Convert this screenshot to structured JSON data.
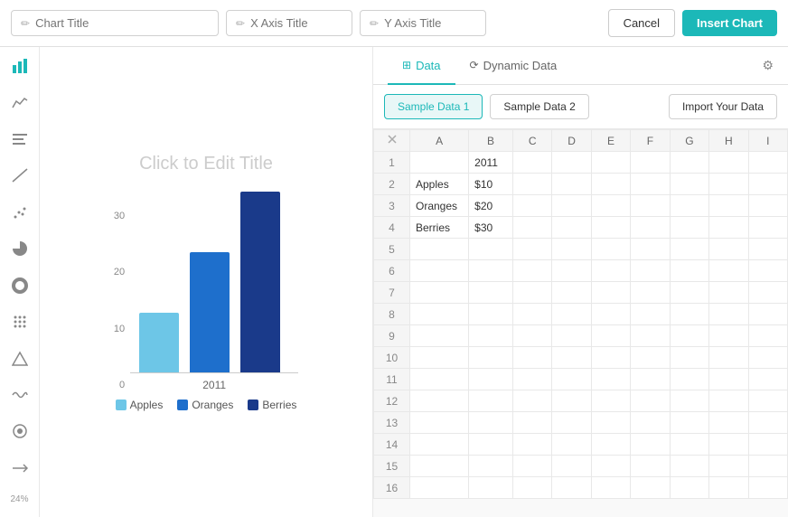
{
  "toolbar": {
    "chart_title_placeholder": "Chart Title",
    "x_axis_placeholder": "X Axis Title",
    "y_axis_placeholder": "Y Axis Title",
    "cancel_label": "Cancel",
    "insert_label": "Insert Chart"
  },
  "sidebar": {
    "icons": [
      {
        "name": "bar-chart-icon",
        "symbol": "▐",
        "active": true
      },
      {
        "name": "area-chart-icon",
        "symbol": "▲"
      },
      {
        "name": "list-chart-icon",
        "symbol": "≡"
      },
      {
        "name": "line-chart-icon",
        "symbol": "╱"
      },
      {
        "name": "scatter-chart-icon",
        "symbol": "⋯"
      },
      {
        "name": "pie-chart-icon",
        "symbol": "◑"
      },
      {
        "name": "donut-chart-icon",
        "symbol": "○"
      },
      {
        "name": "dot-grid-icon",
        "symbol": "⠿"
      },
      {
        "name": "triangle-chart-icon",
        "symbol": "△"
      },
      {
        "name": "wave-icon",
        "symbol": "〜"
      },
      {
        "name": "circle-icon",
        "symbol": "◎"
      },
      {
        "name": "flow-icon",
        "symbol": "⋱"
      }
    ],
    "zoom_label": "24%"
  },
  "chart": {
    "title_placeholder": "Click to Edit Title",
    "year_label": "2011",
    "bars": [
      {
        "label": "Apples",
        "value": 10,
        "color": "#6dc6e7"
      },
      {
        "label": "Oranges",
        "value": 20,
        "color": "#1e6fcc"
      },
      {
        "label": "Berries",
        "value": 30,
        "color": "#1a3a8a"
      }
    ],
    "y_ticks": [
      30,
      20,
      10,
      0
    ]
  },
  "panel": {
    "tab_data_label": "Data",
    "tab_dynamic_label": "Dynamic Data",
    "active_tab": "data",
    "sample1_label": "Sample Data 1",
    "sample2_label": "Sample Data 2",
    "import_label": "Import Your Data"
  },
  "spreadsheet": {
    "col_headers": [
      "",
      "A",
      "B",
      "C",
      "D",
      "E",
      "F",
      "G",
      "H",
      "I"
    ],
    "rows": [
      {
        "row": 1,
        "a": "",
        "b": "2011",
        "c": "",
        "d": "",
        "e": "",
        "f": "",
        "g": "",
        "h": "",
        "i": ""
      },
      {
        "row": 2,
        "a": "Apples",
        "b": "$10",
        "c": "",
        "d": "",
        "e": "",
        "f": "",
        "g": "",
        "h": "",
        "i": ""
      },
      {
        "row": 3,
        "a": "Oranges",
        "b": "$20",
        "c": "",
        "d": "",
        "e": "",
        "f": "",
        "g": "",
        "h": "",
        "i": ""
      },
      {
        "row": 4,
        "a": "Berries",
        "b": "$30",
        "c": "",
        "d": "",
        "e": "",
        "f": "",
        "g": "",
        "h": "",
        "i": ""
      },
      {
        "row": 5,
        "a": "",
        "b": "",
        "c": "",
        "d": "",
        "e": "",
        "f": "",
        "g": "",
        "h": "",
        "i": ""
      },
      {
        "row": 6,
        "a": "",
        "b": "",
        "c": "",
        "d": "",
        "e": "",
        "f": "",
        "g": "",
        "h": "",
        "i": ""
      },
      {
        "row": 7,
        "a": "",
        "b": "",
        "c": "",
        "d": "",
        "e": "",
        "f": "",
        "g": "",
        "h": "",
        "i": ""
      },
      {
        "row": 8,
        "a": "",
        "b": "",
        "c": "",
        "d": "",
        "e": "",
        "f": "",
        "g": "",
        "h": "",
        "i": ""
      },
      {
        "row": 9,
        "a": "",
        "b": "",
        "c": "",
        "d": "",
        "e": "",
        "f": "",
        "g": "",
        "h": "",
        "i": ""
      },
      {
        "row": 10,
        "a": "",
        "b": "",
        "c": "",
        "d": "",
        "e": "",
        "f": "",
        "g": "",
        "h": "",
        "i": ""
      },
      {
        "row": 11,
        "a": "",
        "b": "",
        "c": "",
        "d": "",
        "e": "",
        "f": "",
        "g": "",
        "h": "",
        "i": ""
      },
      {
        "row": 12,
        "a": "",
        "b": "",
        "c": "",
        "d": "",
        "e": "",
        "f": "",
        "g": "",
        "h": "",
        "i": ""
      },
      {
        "row": 13,
        "a": "",
        "b": "",
        "c": "",
        "d": "",
        "e": "",
        "f": "",
        "g": "",
        "h": "",
        "i": ""
      },
      {
        "row": 14,
        "a": "",
        "b": "",
        "c": "",
        "d": "",
        "e": "",
        "f": "",
        "g": "",
        "h": "",
        "i": ""
      },
      {
        "row": 15,
        "a": "",
        "b": "",
        "c": "",
        "d": "",
        "e": "",
        "f": "",
        "g": "",
        "h": "",
        "i": ""
      },
      {
        "row": 16,
        "a": "",
        "b": "",
        "c": "",
        "d": "",
        "e": "",
        "f": "",
        "g": "",
        "h": "",
        "i": ""
      }
    ]
  }
}
